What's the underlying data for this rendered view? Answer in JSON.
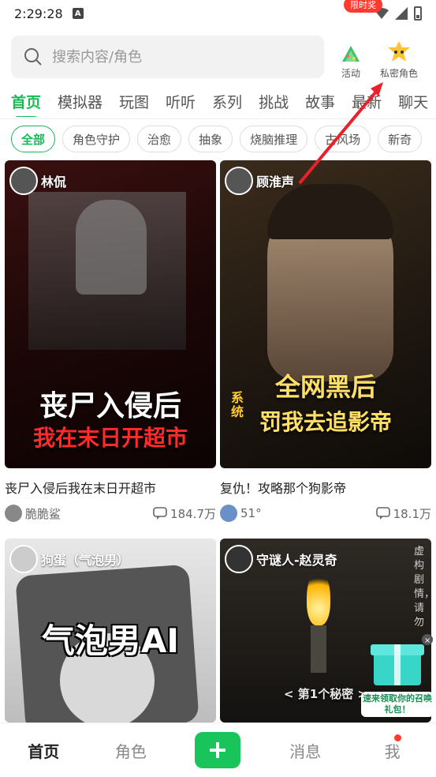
{
  "status": {
    "time": "2:29:28",
    "notif": "A"
  },
  "search": {
    "placeholder": "搜索内容/角色"
  },
  "quick": {
    "activity_label": "活动",
    "badge": "限时奖",
    "private_label": "私密角色"
  },
  "tabs": [
    "首页",
    "模拟器",
    "玩图",
    "听听",
    "系列",
    "挑战",
    "故事",
    "最新",
    "聊天"
  ],
  "chips": [
    "全部",
    "角色守护",
    "治愈",
    "抽象",
    "烧脑推理",
    "古风场",
    "新奇"
  ],
  "cards": [
    {
      "author": "林侃",
      "cover_text_1": "丧尸入侵后",
      "cover_text_2": "我在末日开超市",
      "title": "丧尸入侵后我在末日开超市",
      "user": "脆脆鲨",
      "count": "184.7万"
    },
    {
      "author": "顾淮声",
      "cover_text_1": "全网黑后",
      "cover_text_2": "罚我去追影帝",
      "cover_tag": "系统",
      "title": "复仇！攻略那个狗影帝",
      "user": "51°",
      "count": "18.1万"
    },
    {
      "author": "狗蛋（气泡男）",
      "cover_text_1": "气泡男AI"
    },
    {
      "author": "守谜人-赵灵奇",
      "cover_text_1": "< 第1个秘密 >",
      "side_text": "虚构剧情，请勿"
    }
  ],
  "gift": {
    "label": "速来领取你的召唤礼包！"
  },
  "nav": {
    "home": "首页",
    "roles": "角色",
    "messages": "消息",
    "me": "我"
  },
  "colors": {
    "accent": "#19b955",
    "badge": "#ff3b30",
    "arrow": "#e8212b"
  }
}
